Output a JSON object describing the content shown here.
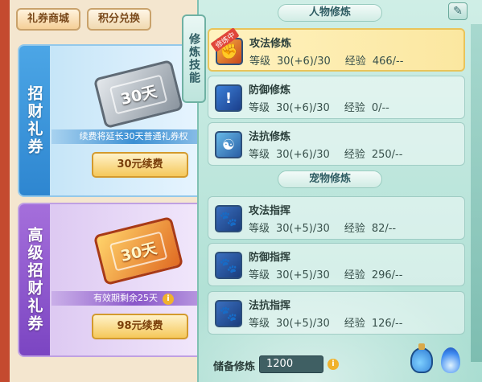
{
  "shop": {
    "tabs": [
      "礼券商城",
      "积分兑换"
    ],
    "cards": [
      {
        "vertical_label": "招财礼券",
        "ticket_text": "30天",
        "note": "续费将延长30天普通礼券权",
        "button": "30元续费"
      },
      {
        "vertical_label": "高级招财礼券",
        "ticket_text": "30天",
        "note": "有效期剩余25天",
        "button": "98元续费"
      }
    ]
  },
  "panel": {
    "side_tab": "修炼技能",
    "person_header": "人物修炼",
    "pet_header": "宠物修炼",
    "level_label": "等级",
    "xp_label": "经验",
    "badge": "修炼中",
    "person_skills": [
      {
        "name": "攻法修炼",
        "level": "30(+6)/30",
        "xp": "466/--",
        "icon": "sword-fist-icon",
        "selected": true
      },
      {
        "name": "防御修炼",
        "level": "30(+6)/30",
        "xp": "0/--",
        "icon": "shield-icon",
        "selected": false
      },
      {
        "name": "法抗修炼",
        "level": "30(+6)/30",
        "xp": "250/--",
        "icon": "yin-yang-shield-icon",
        "selected": false
      }
    ],
    "pet_skills": [
      {
        "name": "攻法指挥",
        "level": "30(+5)/30",
        "xp": "82/--",
        "icon": "paw-attack-icon"
      },
      {
        "name": "防御指挥",
        "level": "30(+5)/30",
        "xp": "296/--",
        "icon": "paw-shield-icon"
      },
      {
        "name": "法抗指挥",
        "level": "30(+5)/30",
        "xp": "126/--",
        "icon": "paw-magic-icon"
      }
    ],
    "storage_label": "储备修炼",
    "storage_value": "1200",
    "info_glyph": "i",
    "edit_glyph": "✎"
  }
}
